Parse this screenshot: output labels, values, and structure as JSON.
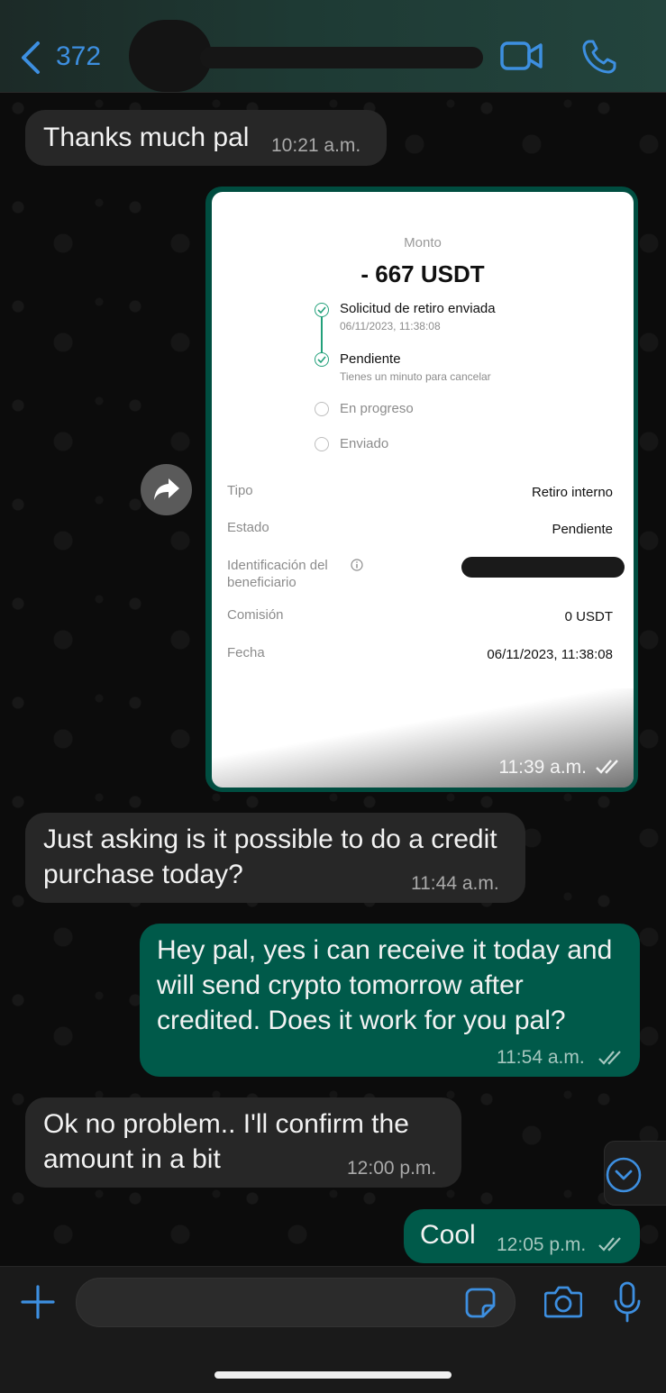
{
  "header": {
    "back_count": "372"
  },
  "messages": [
    {
      "text": "Thanks much pal",
      "time": "10:21 a.m."
    },
    {
      "text": "Just asking is it possible to do a credit\npurchase today?",
      "time": "11:44 a.m."
    },
    {
      "text": "Hey pal, yes i can receive it today and\nwill send crypto tomorrow after\ncredited. Does it work for you pal?",
      "time": "11:54 a.m."
    },
    {
      "text": "Ok no problem.. I'll confirm the\namount in a bit",
      "time": "12:00 p.m."
    },
    {
      "text": "Cool",
      "time": "12:05 p.m."
    }
  ],
  "receipt": {
    "monto_label": "Monto",
    "amount": "- 667 USDT",
    "steps": [
      {
        "title": "Solicitud de retiro enviada",
        "sub": "06/11/2023, 11:38:08"
      },
      {
        "title": "Pendiente",
        "sub": "Tienes un minuto para cancelar"
      },
      {
        "title": "En progreso"
      },
      {
        "title": "Enviado"
      }
    ],
    "rows": {
      "tipo_label": "Tipo",
      "tipo_value": "Retiro interno",
      "estado_label": "Estado",
      "estado_value": "Pendiente",
      "beneficiario_label": "Identificación del\nbeneficiario",
      "comision_label": "Comisión",
      "comision_value": "0 USDT",
      "fecha_label": "Fecha",
      "fecha_value": "06/11/2023, 11:38:08"
    },
    "time": "11:39 a.m."
  },
  "colors": {
    "accent": "#3d8fe0",
    "outgoing": "#005a4a",
    "incoming": "#272727"
  },
  "icons": [
    "chevron-left-icon",
    "video-camera-icon",
    "phone-icon",
    "forward-icon",
    "chevron-down-circle-icon",
    "plus-icon",
    "sticker-icon",
    "camera-icon",
    "microphone-icon",
    "double-check-icon"
  ]
}
